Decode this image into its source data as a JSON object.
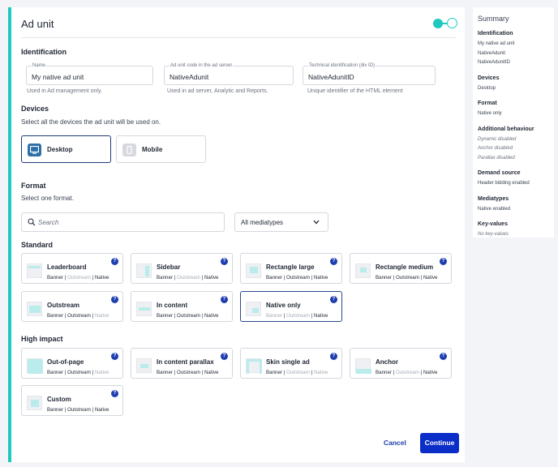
{
  "title": "Ad unit",
  "identification": {
    "heading": "Identification",
    "name": {
      "label": "Name",
      "value": "My native ad unit",
      "hint": "Used in Ad management only."
    },
    "code": {
      "label": "Ad unit code in the ad server",
      "value": "NativeAdunit",
      "hint": "Used in ad server, Analytic and Reports."
    },
    "tech": {
      "label": "Technical identification (div ID)",
      "value": "NativeAdunitID",
      "hint": "Unique identifier of the HTML element"
    }
  },
  "devices": {
    "heading": "Devices",
    "subtitle": "Select all the devices the ad unit will be used on.",
    "items": [
      {
        "label": "Desktop",
        "selected": true,
        "icon": "monitor-icon"
      },
      {
        "label": "Mobile",
        "selected": false,
        "icon": "mobile-icon"
      }
    ]
  },
  "format": {
    "heading": "Format",
    "subtitle": "Select one format.",
    "search_placeholder": "Search",
    "mediatype_select": "All mediatypes",
    "standard_heading": "Standard",
    "high_impact_heading": "High impact",
    "standard": [
      {
        "name": "Leaderboard",
        "tags": [
          [
            "Banner",
            true
          ],
          [
            "Outstream",
            false
          ],
          [
            "Native",
            true
          ]
        ],
        "thumb": "leaderboard"
      },
      {
        "name": "Sidebar",
        "tags": [
          [
            "Banner",
            true
          ],
          [
            "Outstream",
            false
          ],
          [
            "Native",
            true
          ]
        ],
        "thumb": "sidebar"
      },
      {
        "name": "Rectangle large",
        "tags": [
          [
            "Banner",
            true
          ],
          [
            "Outstream",
            true
          ],
          [
            "Native",
            true
          ]
        ],
        "thumb": "rect-large"
      },
      {
        "name": "Rectangle medium",
        "tags": [
          [
            "Banner",
            true
          ],
          [
            "Outstream",
            true
          ],
          [
            "Native",
            true
          ]
        ],
        "thumb": "rect-medium"
      },
      {
        "name": "Outstream",
        "tags": [
          [
            "Banner",
            true
          ],
          [
            "Outstream",
            true
          ],
          [
            "Native",
            false
          ]
        ],
        "thumb": "outstream"
      },
      {
        "name": "In content",
        "tags": [
          [
            "Banner",
            true
          ],
          [
            "Outstream",
            true
          ],
          [
            "Native",
            true
          ]
        ],
        "thumb": "in-content"
      },
      {
        "name": "Native only",
        "tags": [
          [
            "Banner",
            false
          ],
          [
            "Outstream",
            false
          ],
          [
            "Native",
            true
          ]
        ],
        "thumb": "native",
        "selected": true
      }
    ],
    "high_impact": [
      {
        "name": "Out-of-page",
        "tags": [
          [
            "Banner",
            true
          ],
          [
            "Outstream",
            true
          ],
          [
            "Native",
            false
          ]
        ],
        "thumb": "out-of-page"
      },
      {
        "name": "In content parallax",
        "tags": [
          [
            "Banner",
            true
          ],
          [
            "Outstream",
            true
          ],
          [
            "Native",
            true
          ]
        ],
        "thumb": "parallax"
      },
      {
        "name": "Skin single ad",
        "tags": [
          [
            "Banner",
            true
          ],
          [
            "Outstream",
            false
          ],
          [
            "Native",
            false
          ]
        ],
        "thumb": "skin"
      },
      {
        "name": "Anchor",
        "tags": [
          [
            "Banner",
            true
          ],
          [
            "Outstream",
            false
          ],
          [
            "Native",
            true
          ]
        ],
        "thumb": "anchor"
      },
      {
        "name": "Custom",
        "tags": [
          [
            "Banner",
            true
          ],
          [
            "Outstream",
            true
          ],
          [
            "Native",
            true
          ]
        ],
        "thumb": "custom"
      }
    ]
  },
  "actions": {
    "cancel": "Cancel",
    "continue": "Continue"
  },
  "summary": {
    "title": "Summary",
    "sections": [
      {
        "heading": "Identification",
        "values": [
          "My native ad unit",
          "NativeAdunit",
          "NativeAdunitID"
        ]
      },
      {
        "heading": "Devices",
        "values": [
          "Desktop"
        ]
      },
      {
        "heading": "Format",
        "values": [
          "Native only"
        ]
      },
      {
        "heading": "Additional behaviour",
        "values": [
          "Dynamic disabled",
          "Anchor disabled",
          "Parallax disabled"
        ],
        "italic": true
      },
      {
        "heading": "Demand source",
        "values": [
          "Header bidding enabled"
        ]
      },
      {
        "heading": "Mediatypes",
        "values": [
          "Native enabled"
        ]
      },
      {
        "heading": "Key-values",
        "values": [
          "No key-values"
        ],
        "italic": true
      }
    ]
  },
  "colors": {
    "accent": "#1ec9c0",
    "primary": "#0b2dc8",
    "help": "#1f3fb0"
  }
}
